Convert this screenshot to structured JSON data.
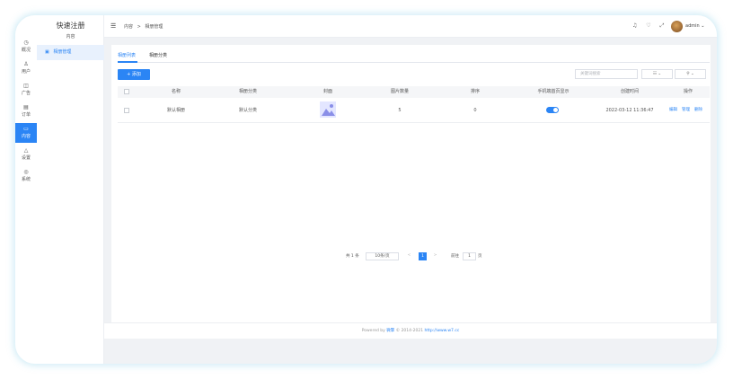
{
  "rail": [
    {
      "icon": "◷",
      "label": "概况"
    },
    {
      "icon": "♙",
      "label": "用户"
    },
    {
      "icon": "◫",
      "label": "广告"
    },
    {
      "icon": "▤",
      "label": "订单"
    },
    {
      "icon": "▭",
      "label": "内容"
    },
    {
      "icon": "△",
      "label": "设置"
    },
    {
      "icon": "◎",
      "label": "系统"
    }
  ],
  "brand": {
    "title": "快速注册",
    "subtitle": "内容"
  },
  "side_menu": {
    "item": "相册管理",
    "icon": "▣"
  },
  "header": {
    "menu_icon": "☰",
    "breadcrumb": [
      "内容",
      ">",
      "相册管理"
    ],
    "icons": "♫ ♡ ⤢ ⟳",
    "username": "admin ⌄"
  },
  "tabs": [
    "相册列表",
    "相册分类"
  ],
  "toolbar": {
    "add_label": "+ 添加",
    "search_placeholder": "关键词搜索",
    "select1": "☷ ⌄",
    "select2": "⚲ ⌄"
  },
  "table": {
    "headers": [
      "名称",
      "相册分类",
      "封面",
      "图片数量",
      "排序",
      "手机端首页显示",
      "创建时间",
      "操作"
    ],
    "rows": [
      {
        "name": "默认相册",
        "category": "默认分类",
        "count": "5",
        "sort": "0",
        "created": "2022-03-12 11:36:47",
        "ops": [
          "编辑",
          "管理",
          "删除"
        ]
      }
    ]
  },
  "pagination": {
    "total": "共 1 条",
    "per_page": "10条/页",
    "prev": "<",
    "current": "1",
    "next": ">",
    "goto": "前往",
    "goto_page": "1",
    "page_unit": "页"
  },
  "footer": {
    "text": "Powered by ",
    "brand": "微擎",
    "copyright": " © 2014-2021 ",
    "link": "http://www.w7.cc"
  }
}
